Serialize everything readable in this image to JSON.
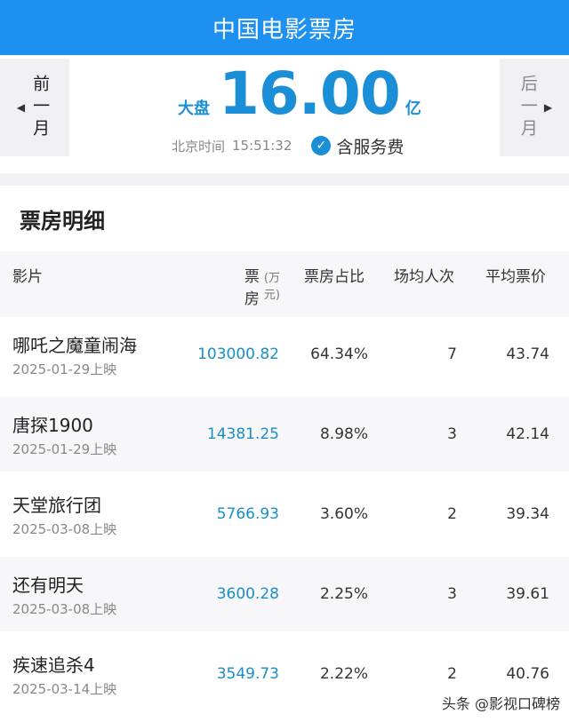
{
  "header": {
    "title": "中国电影票房"
  },
  "summary": {
    "prev_month": "前一月",
    "next_month": "后一月",
    "gross_label": "大盘",
    "gross_value": "16.00",
    "gross_unit": "亿",
    "time_label": "北京时间",
    "time_value": "15:51:32",
    "service_fee": "含服务费"
  },
  "detail": {
    "heading": "票房明细",
    "columns": {
      "film": "影片",
      "gross": "票房",
      "gross_unit": "(万元)",
      "share": "票房占比",
      "avg_people": "场均人次",
      "avg_price": "平均票价"
    },
    "rows": [
      {
        "name": "哪吒之魔童闹海",
        "release": "2025-01-29上映",
        "gross": "103000.82",
        "share": "64.34%",
        "avg_people": "7",
        "avg_price": "43.74"
      },
      {
        "name": "唐探1900",
        "release": "2025-01-29上映",
        "gross": "14381.25",
        "share": "8.98%",
        "avg_people": "3",
        "avg_price": "42.14"
      },
      {
        "name": "天堂旅行团",
        "release": "2025-03-08上映",
        "gross": "5766.93",
        "share": "3.60%",
        "avg_people": "2",
        "avg_price": "39.34"
      },
      {
        "name": "还有明天",
        "release": "2025-03-08上映",
        "gross": "3600.28",
        "share": "2.25%",
        "avg_people": "3",
        "avg_price": "39.61"
      },
      {
        "name": "疾速追杀4",
        "release": "2025-03-14上映",
        "gross": "3549.73",
        "share": "2.22%",
        "avg_people": "2",
        "avg_price": "40.76"
      }
    ]
  },
  "watermark": "头条 @影视口碑榜"
}
